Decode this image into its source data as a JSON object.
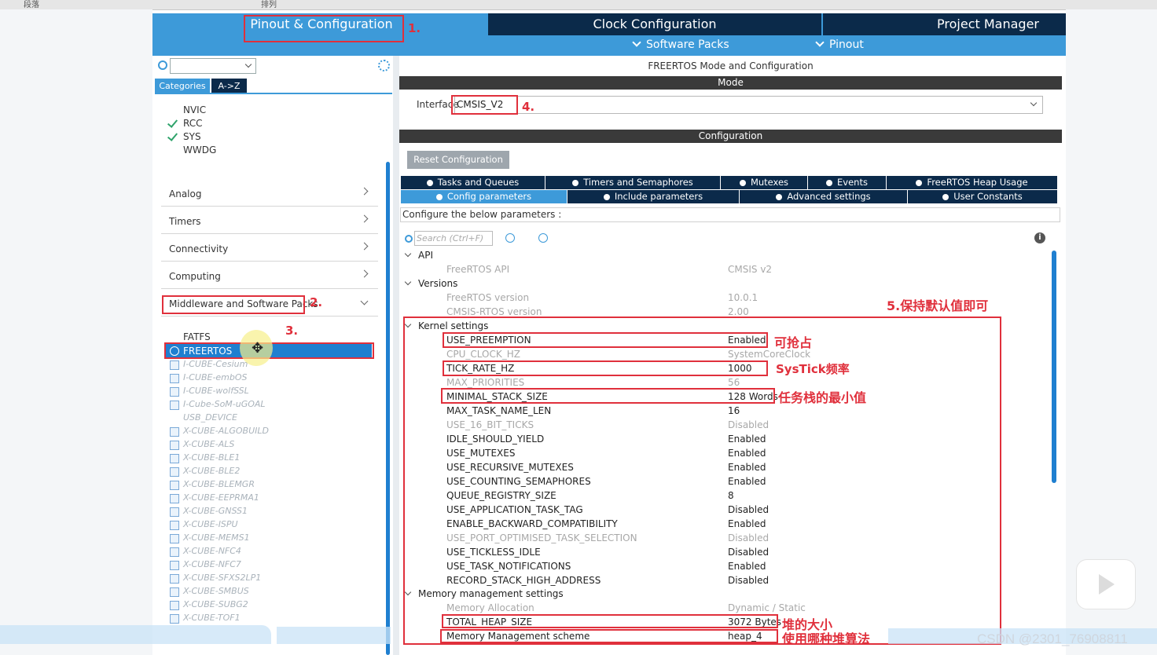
{
  "top_strip": {
    "left": "段落",
    "mid": "排列"
  },
  "header": {
    "tab_pinout": "Pinout & Configuration",
    "tab_clock": "Clock Configuration",
    "tab_project": "Project Manager",
    "nav_software_packs": "Software Packs",
    "nav_pinout": "Pinout"
  },
  "left": {
    "tab_categories": "Categories",
    "tab_az": "A->Z",
    "tree_top": [
      "NVIC",
      "RCC",
      "SYS",
      "WWDG"
    ],
    "sections": [
      "Analog",
      "Timers",
      "Connectivity",
      "Computing",
      "Middleware and Software Packs"
    ],
    "fatfs": "FATFS",
    "freertos": "FREERTOS",
    "packages": [
      "I-CUBE-Cesium",
      "I-CUBE-embOS",
      "I-CUBE-wolfSSL",
      "I-Cube-SoM-uGOAL",
      "USB_DEVICE",
      "X-CUBE-ALGOBUILD",
      "X-CUBE-ALS",
      "X-CUBE-BLE1",
      "X-CUBE-BLE2",
      "X-CUBE-BLEMGR",
      "X-CUBE-EEPRMA1",
      "X-CUBE-GNSS1",
      "X-CUBE-ISPU",
      "X-CUBE-MEMS1",
      "X-CUBE-NFC4",
      "X-CUBE-NFC7",
      "X-CUBE-SFXS2LP1",
      "X-CUBE-SMBUS",
      "X-CUBE-SUBG2",
      "X-CUBE-TOF1"
    ]
  },
  "right": {
    "title": "FREERTOS Mode and Configuration",
    "mode_label": "Mode",
    "interface_label": "Interface",
    "interface_value": "CMSIS_V2",
    "config_label": "Configuration",
    "reset_button": "Reset Configuration",
    "tabs_row1": [
      "Tasks and Queues",
      "Timers and Semaphores",
      "Mutexes",
      "Events",
      "FreeRTOS Heap Usage"
    ],
    "tabs_row2": [
      "Config parameters",
      "Include parameters",
      "Advanced settings",
      "User Constants"
    ],
    "configure_text": "Configure the below parameters :",
    "search_placeholder": "Search (Ctrl+F)",
    "groups": {
      "api": "API",
      "versions": "Versions",
      "kernel": "Kernel settings",
      "memory": "Memory management settings"
    },
    "api_rows": [
      {
        "name": "FreeRTOS API",
        "value": "CMSIS v2"
      }
    ],
    "version_rows": [
      {
        "name": "FreeRTOS version",
        "value": "10.0.1"
      },
      {
        "name": "CMSIS-RTOS version",
        "value": "2.00"
      }
    ],
    "kernel_rows": [
      {
        "name": "USE_PREEMPTION",
        "value": "Enabled"
      },
      {
        "name": "CPU_CLOCK_HZ",
        "value": "SystemCoreClock"
      },
      {
        "name": "TICK_RATE_HZ",
        "value": "1000"
      },
      {
        "name": "MAX_PRIORITIES",
        "value": "56"
      },
      {
        "name": "MINIMAL_STACK_SIZE",
        "value": "128 Words"
      },
      {
        "name": "MAX_TASK_NAME_LEN",
        "value": "16"
      },
      {
        "name": "USE_16_BIT_TICKS",
        "value": "Disabled"
      },
      {
        "name": "IDLE_SHOULD_YIELD",
        "value": "Enabled"
      },
      {
        "name": "USE_MUTEXES",
        "value": "Enabled"
      },
      {
        "name": "USE_RECURSIVE_MUTEXES",
        "value": "Enabled"
      },
      {
        "name": "USE_COUNTING_SEMAPHORES",
        "value": "Enabled"
      },
      {
        "name": "QUEUE_REGISTRY_SIZE",
        "value": "8"
      },
      {
        "name": "USE_APPLICATION_TASK_TAG",
        "value": "Disabled"
      },
      {
        "name": "ENABLE_BACKWARD_COMPATIBILITY",
        "value": "Enabled"
      },
      {
        "name": "USE_PORT_OPTIMISED_TASK_SELECTION",
        "value": "Disabled"
      },
      {
        "name": "USE_TICKLESS_IDLE",
        "value": "Disabled"
      },
      {
        "name": "USE_TASK_NOTIFICATIONS",
        "value": "Enabled"
      },
      {
        "name": "RECORD_STACK_HIGH_ADDRESS",
        "value": "Disabled"
      }
    ],
    "memory_rows": [
      {
        "name": "Memory Allocation",
        "value": "Dynamic / Static"
      },
      {
        "name": "TOTAL_HEAP_SIZE",
        "value": "3072 Bytes"
      },
      {
        "name": "Memory Management scheme",
        "value": "heap_4"
      }
    ]
  },
  "annotations": {
    "n1": "1.",
    "n2": "2.",
    "n3": "3.",
    "n4": "4.",
    "n5": "5.保持默认值即可",
    "preempt": "可抢占",
    "systick": "SysTick频率",
    "stack": "任务栈的最小值",
    "heap": "堆的大小",
    "scheme": "使用哪种堆算法"
  },
  "watermark": "CSDN @2301_76908811",
  "colors": {
    "header_blue": "#3d9ad9",
    "dark_navy": "#0b2a4a",
    "annotation_red": "#e0303c"
  }
}
